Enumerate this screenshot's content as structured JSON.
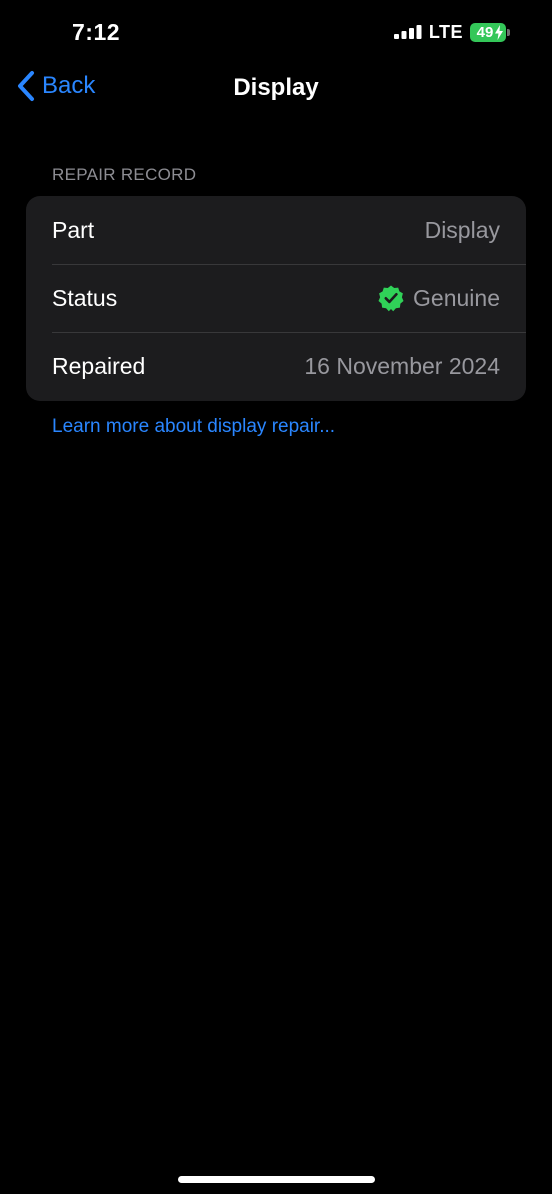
{
  "status_bar": {
    "time": "7:12",
    "network": "LTE",
    "battery_level": "49",
    "battery_charging": true,
    "signal_icon": "signal-bars-icon",
    "battery_icon": "battery-charging-icon"
  },
  "nav": {
    "back_label": "Back",
    "back_icon": "chevron-left-icon",
    "title": "Display"
  },
  "section": {
    "header": "REPAIR RECORD",
    "rows": [
      {
        "label": "Part",
        "value": "Display"
      },
      {
        "label": "Status",
        "value": "Genuine",
        "icon": "verified-badge-icon"
      },
      {
        "label": "Repaired",
        "value": "16 November 2024"
      }
    ]
  },
  "link": {
    "text": "Learn more about display repair..."
  },
  "colors": {
    "background": "#000000",
    "card": "#1c1c1e",
    "accent": "#2a86ff",
    "secondary_text": "#98989e",
    "verified": "#30d158",
    "battery": "#34c759"
  }
}
